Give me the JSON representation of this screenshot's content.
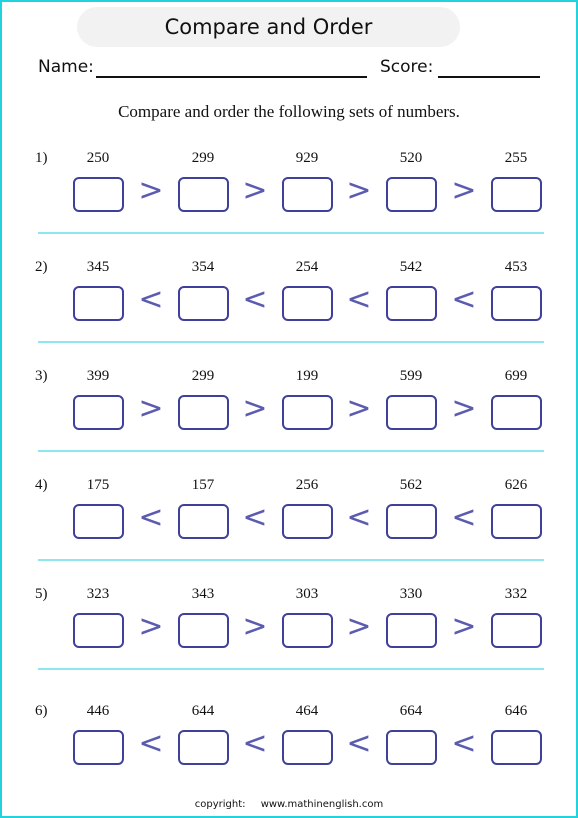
{
  "header": {
    "title": "Compare and Order",
    "name_label": "Name:",
    "score_label": "Score:"
  },
  "instructions": "Compare and order the following sets of numbers.",
  "problems": [
    {
      "label": "1)",
      "numbers": [
        "250",
        "299",
        "929",
        "520",
        "255"
      ],
      "operator": ">"
    },
    {
      "label": "2)",
      "numbers": [
        "345",
        "354",
        "254",
        "542",
        "453"
      ],
      "operator": "<"
    },
    {
      "label": "3)",
      "numbers": [
        "399",
        "299",
        "199",
        "599",
        "699"
      ],
      "operator": ">"
    },
    {
      "label": "4)",
      "numbers": [
        "175",
        "157",
        "256",
        "562",
        "626"
      ],
      "operator": "<"
    },
    {
      "label": "5)",
      "numbers": [
        "323",
        "343",
        "303",
        "330",
        "332"
      ],
      "operator": ">"
    },
    {
      "label": "6)",
      "numbers": [
        "446",
        "644",
        "464",
        "664",
        "646"
      ],
      "operator": "<"
    }
  ],
  "footer": {
    "copyright_label": "copyright:",
    "site": "www.mathinenglish.com"
  },
  "colors": {
    "border": "#22d3dd",
    "box_border": "#3f3f9c",
    "operator": "#5b5bb0",
    "divider": "#8ee6ee",
    "title_bg": "#f2f2f2"
  }
}
